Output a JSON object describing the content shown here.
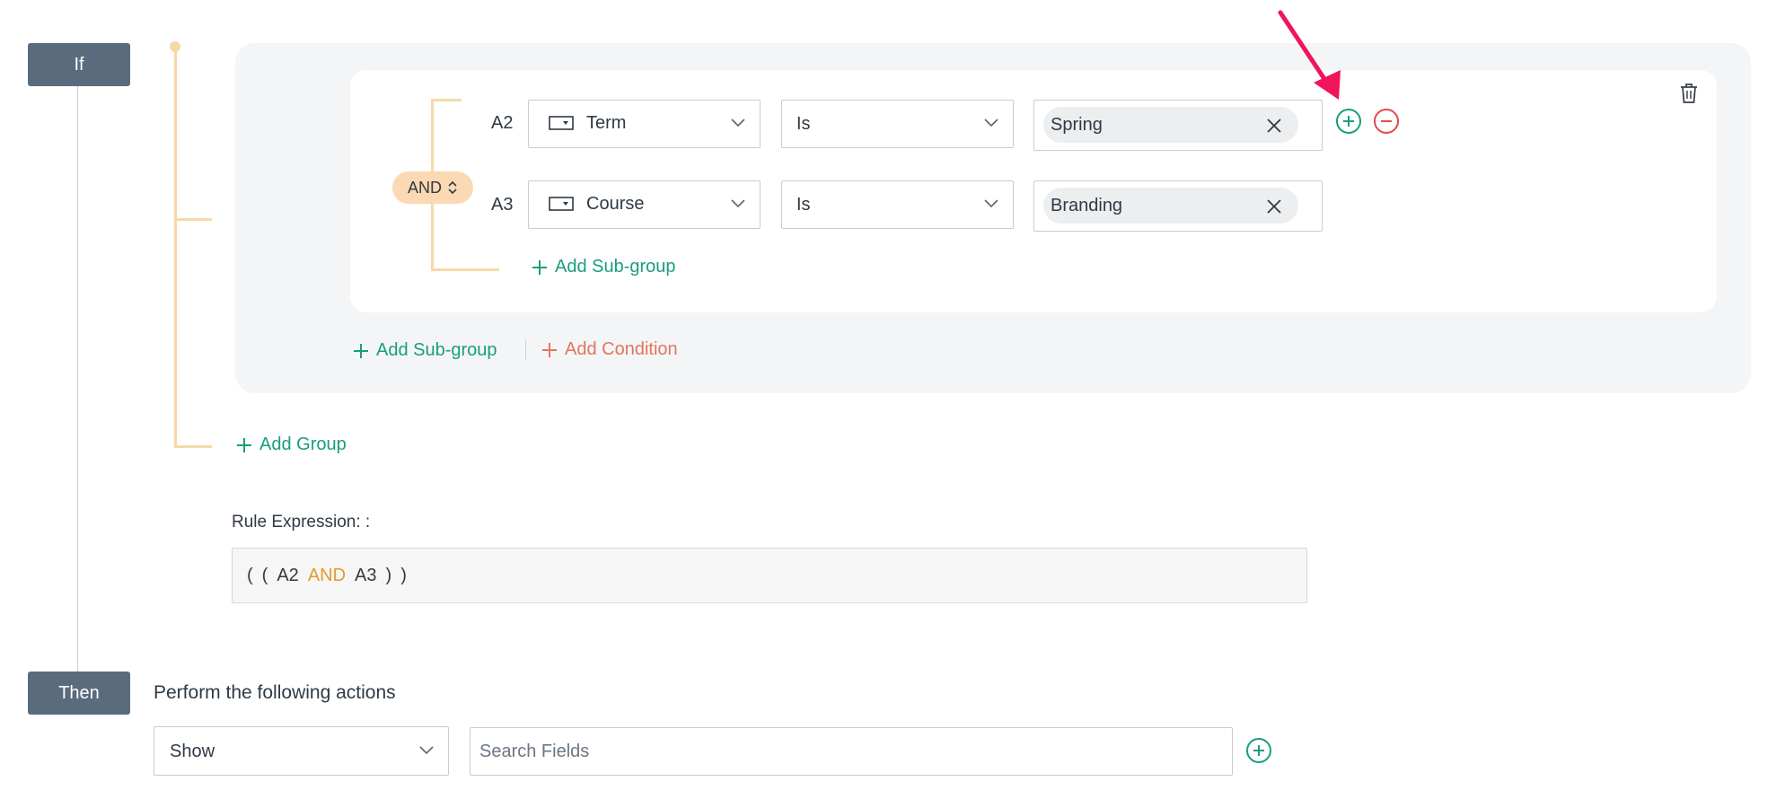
{
  "if_badge": "If",
  "then_badge": "Then",
  "group": {
    "operator": "AND",
    "conditions": [
      {
        "id": "A2",
        "field": "Term",
        "operator": "Is",
        "value": "Spring"
      },
      {
        "id": "A3",
        "field": "Course",
        "operator": "Is",
        "value": "Branding"
      }
    ],
    "inner_add_subgroup": "Add Sub-group",
    "add_subgroup": "Add Sub-group",
    "add_condition": "Add Condition"
  },
  "add_group": "Add Group",
  "rule_expression": {
    "label": "Rule Expression: :",
    "open1": "(",
    "open2": "(",
    "a": "A2",
    "op": "AND",
    "b": "A3",
    "close1": ")",
    "close2": ")"
  },
  "actions": {
    "title": "Perform the following actions",
    "action_select": "Show",
    "search_placeholder": "Search Fields"
  },
  "colors": {
    "badge": "#5a6b7d",
    "accent_green": "#1a9d7d",
    "accent_red": "#e0765e",
    "remove_red": "#e24a4a",
    "connector": "#f7d9a8",
    "and_pill": "#fbd9b3",
    "annotation_arrow": "#f0145a"
  }
}
